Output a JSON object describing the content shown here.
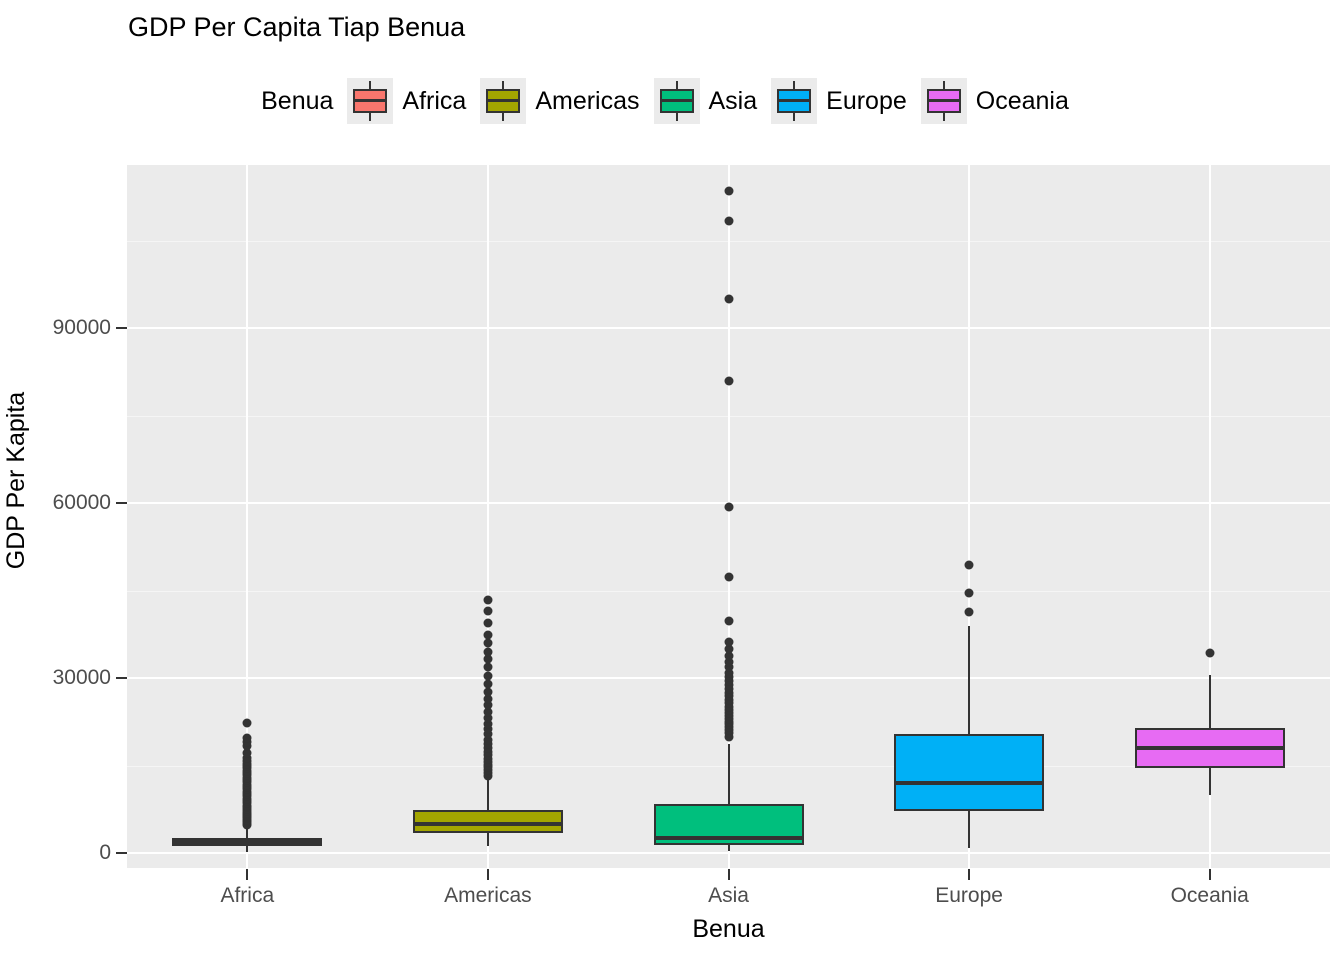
{
  "chart_data": {
    "type": "box",
    "title": "GDP Per Capita Tiap Benua",
    "xlabel": "Benua",
    "ylabel": "GDP Per Kapita",
    "legend_title": "Benua",
    "legend_position": "top",
    "grid": true,
    "categories": [
      "Africa",
      "Americas",
      "Asia",
      "Europe",
      "Oceania"
    ],
    "y_ticks": [
      0,
      30000,
      60000,
      90000
    ],
    "y_tick_labels": [
      "0",
      "30000",
      "60000",
      "90000"
    ],
    "ylim": [
      -2500,
      118000
    ],
    "colors": {
      "Africa": "#F8766D",
      "Americas": "#A3A500",
      "Asia": "#00BF7D",
      "Europe": "#00B0F6",
      "Oceania": "#E76BF3"
    },
    "box_line_color": "#333333",
    "panel_background": "#EBEBEB",
    "gridline_color": "#FFFFFF",
    "boxes": [
      {
        "category": "Africa",
        "color": "#F8766D",
        "whisker_low": 241,
        "q1": 1200,
        "median": 1950,
        "q3": 2700,
        "whisker_high": 4700,
        "outliers": [
          4800,
          5100,
          5300,
          5600,
          5800,
          6000,
          6200,
          6400,
          6600,
          6800,
          7000,
          7300,
          7600,
          7900,
          8200,
          8600,
          9000,
          9400,
          9800,
          10200,
          10600,
          11000,
          11400,
          11800,
          12200,
          12600,
          13000,
          13400,
          13800,
          14200,
          14600,
          15000,
          15400,
          15900,
          16400,
          17200,
          18400,
          19100,
          19700,
          22300
        ]
      },
      {
        "category": "Americas",
        "color": "#A3A500",
        "whisker_low": 1200,
        "q1": 3500,
        "median": 5000,
        "q3": 7500,
        "whisker_high": 13000,
        "outliers": [
          13300,
          13800,
          14300,
          14800,
          15200,
          15700,
          16200,
          16800,
          17400,
          18000,
          18700,
          19500,
          20400,
          21300,
          22200,
          23200,
          24300,
          25400,
          26500,
          27700,
          29000,
          30400,
          31900,
          33300,
          34600,
          36000,
          37500,
          39500,
          41500,
          43500
        ]
      },
      {
        "category": "Asia",
        "color": "#00BF7D",
        "whisker_low": 331,
        "q1": 1500,
        "median": 2600,
        "q3": 8500,
        "whisker_high": 18800,
        "outliers": [
          20000,
          20600,
          21100,
          21600,
          22100,
          22600,
          23100,
          23600,
          24100,
          24600,
          25100,
          25700,
          26300,
          26900,
          27500,
          28100,
          28800,
          29500,
          30200,
          31000,
          31900,
          32800,
          33800,
          35000,
          36300,
          39800,
          47300,
          59300,
          80900,
          95000,
          108400,
          113500
        ]
      },
      {
        "category": "Europe",
        "color": "#00B0F6",
        "whisker_low": 974,
        "q1": 7200,
        "median": 12000,
        "q3": 20500,
        "whisker_high": 39000,
        "outliers": [
          41300,
          44600,
          49400
        ]
      },
      {
        "category": "Oceania",
        "color": "#E76BF3",
        "whisker_low": 10000,
        "q1": 14600,
        "median": 18000,
        "q3": 21500,
        "whisker_high": 30500,
        "outliers": [
          34400
        ]
      }
    ]
  }
}
